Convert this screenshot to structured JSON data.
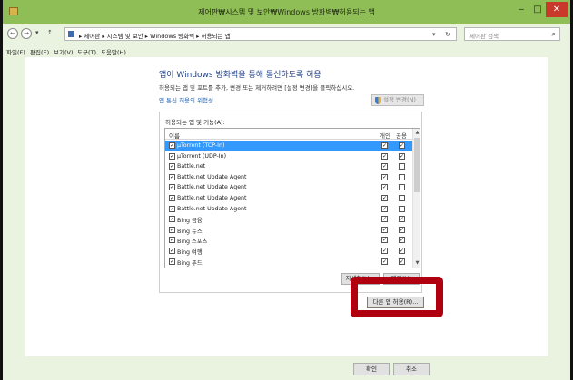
{
  "window": {
    "title": "제어판₩시스템 및 보안₩Windows 방화벽₩허용되는 앱",
    "minimize_label": "‒",
    "maximize_label": "□",
    "close_label": "✕"
  },
  "nav": {
    "back_label": "←",
    "forward_label": "→",
    "dropdown_label": "▾",
    "up_label": "↑",
    "address_path": "▸ 제어판 ▸ 시스템 및 보안 ▸ Windows 방화벽 ▸ 허용되는 앱",
    "address_dropdown": "▾",
    "refresh_label": "↻",
    "search_placeholder": "제어판 검색",
    "search_icon": "⌕"
  },
  "menu": {
    "items": [
      "파일(F)",
      "편집(E)",
      "보기(V)",
      "도구(T)",
      "도움말(H)"
    ]
  },
  "main": {
    "heading": "앱이 Windows 방화벽을 통해 통신하도록 허용",
    "description": "허용되는 앱 및 포트를 추가, 변경 또는 제거하려면 [설정 변경]을 클릭하십시오.",
    "risk_link": "앱 통신 허용의 위험성",
    "change_settings_label": "설정 변경(N)",
    "group_label": "허용되는 앱 및 기능(A):",
    "columns": {
      "name": "이름",
      "private": "개인",
      "public": "공용"
    },
    "rows": [
      {
        "name": "μTorrent (TCP-In)",
        "private": true,
        "public": true,
        "selected": true
      },
      {
        "name": "μTorrent (UDP-In)",
        "private": true,
        "public": true,
        "selected": false
      },
      {
        "name": "Battle.net",
        "private": true,
        "public": false,
        "selected": false
      },
      {
        "name": "Battle.net Update Agent",
        "private": true,
        "public": false,
        "selected": false
      },
      {
        "name": "Battle.net Update Agent",
        "private": true,
        "public": false,
        "selected": false
      },
      {
        "name": "Battle.net Update Agent",
        "private": true,
        "public": false,
        "selected": false
      },
      {
        "name": "Battle.net Update Agent",
        "private": true,
        "public": false,
        "selected": false
      },
      {
        "name": "Bing 금융",
        "private": true,
        "public": true,
        "selected": false
      },
      {
        "name": "Bing 뉴스",
        "private": true,
        "public": true,
        "selected": false
      },
      {
        "name": "Bing 스포츠",
        "private": true,
        "public": true,
        "selected": false
      },
      {
        "name": "Bing 여행",
        "private": true,
        "public": true,
        "selected": false
      },
      {
        "name": "Bing 푸드",
        "private": true,
        "public": true,
        "selected": false
      }
    ],
    "details_label": "자세히(L)...",
    "remove_label": "제거(M)",
    "other_app_label": "다른 앱 허용(R)..."
  },
  "footer": {
    "ok_label": "확인",
    "cancel_label": "취소"
  },
  "colors": {
    "titlebar": "#8fbd56",
    "window_bg": "#eaf3df",
    "selection": "#3399ff",
    "highlight_frame": "#b00010",
    "heading": "#1e3f8a"
  }
}
